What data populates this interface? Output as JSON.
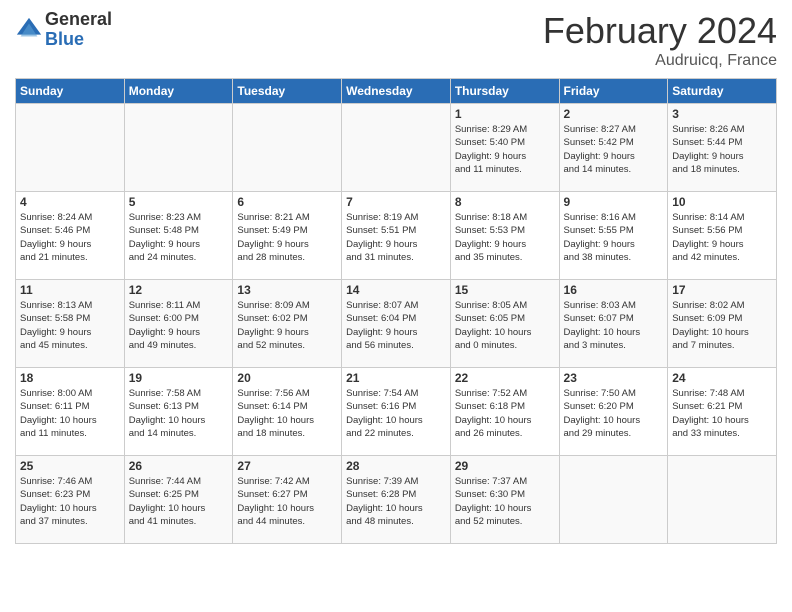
{
  "header": {
    "logo_general": "General",
    "logo_blue": "Blue",
    "title": "February 2024",
    "subtitle": "Audruicq, France"
  },
  "days_of_week": [
    "Sunday",
    "Monday",
    "Tuesday",
    "Wednesday",
    "Thursday",
    "Friday",
    "Saturday"
  ],
  "weeks": [
    [
      {
        "num": "",
        "info": ""
      },
      {
        "num": "",
        "info": ""
      },
      {
        "num": "",
        "info": ""
      },
      {
        "num": "",
        "info": ""
      },
      {
        "num": "1",
        "info": "Sunrise: 8:29 AM\nSunset: 5:40 PM\nDaylight: 9 hours\nand 11 minutes."
      },
      {
        "num": "2",
        "info": "Sunrise: 8:27 AM\nSunset: 5:42 PM\nDaylight: 9 hours\nand 14 minutes."
      },
      {
        "num": "3",
        "info": "Sunrise: 8:26 AM\nSunset: 5:44 PM\nDaylight: 9 hours\nand 18 minutes."
      }
    ],
    [
      {
        "num": "4",
        "info": "Sunrise: 8:24 AM\nSunset: 5:46 PM\nDaylight: 9 hours\nand 21 minutes."
      },
      {
        "num": "5",
        "info": "Sunrise: 8:23 AM\nSunset: 5:48 PM\nDaylight: 9 hours\nand 24 minutes."
      },
      {
        "num": "6",
        "info": "Sunrise: 8:21 AM\nSunset: 5:49 PM\nDaylight: 9 hours\nand 28 minutes."
      },
      {
        "num": "7",
        "info": "Sunrise: 8:19 AM\nSunset: 5:51 PM\nDaylight: 9 hours\nand 31 minutes."
      },
      {
        "num": "8",
        "info": "Sunrise: 8:18 AM\nSunset: 5:53 PM\nDaylight: 9 hours\nand 35 minutes."
      },
      {
        "num": "9",
        "info": "Sunrise: 8:16 AM\nSunset: 5:55 PM\nDaylight: 9 hours\nand 38 minutes."
      },
      {
        "num": "10",
        "info": "Sunrise: 8:14 AM\nSunset: 5:56 PM\nDaylight: 9 hours\nand 42 minutes."
      }
    ],
    [
      {
        "num": "11",
        "info": "Sunrise: 8:13 AM\nSunset: 5:58 PM\nDaylight: 9 hours\nand 45 minutes."
      },
      {
        "num": "12",
        "info": "Sunrise: 8:11 AM\nSunset: 6:00 PM\nDaylight: 9 hours\nand 49 minutes."
      },
      {
        "num": "13",
        "info": "Sunrise: 8:09 AM\nSunset: 6:02 PM\nDaylight: 9 hours\nand 52 minutes."
      },
      {
        "num": "14",
        "info": "Sunrise: 8:07 AM\nSunset: 6:04 PM\nDaylight: 9 hours\nand 56 minutes."
      },
      {
        "num": "15",
        "info": "Sunrise: 8:05 AM\nSunset: 6:05 PM\nDaylight: 10 hours\nand 0 minutes."
      },
      {
        "num": "16",
        "info": "Sunrise: 8:03 AM\nSunset: 6:07 PM\nDaylight: 10 hours\nand 3 minutes."
      },
      {
        "num": "17",
        "info": "Sunrise: 8:02 AM\nSunset: 6:09 PM\nDaylight: 10 hours\nand 7 minutes."
      }
    ],
    [
      {
        "num": "18",
        "info": "Sunrise: 8:00 AM\nSunset: 6:11 PM\nDaylight: 10 hours\nand 11 minutes."
      },
      {
        "num": "19",
        "info": "Sunrise: 7:58 AM\nSunset: 6:13 PM\nDaylight: 10 hours\nand 14 minutes."
      },
      {
        "num": "20",
        "info": "Sunrise: 7:56 AM\nSunset: 6:14 PM\nDaylight: 10 hours\nand 18 minutes."
      },
      {
        "num": "21",
        "info": "Sunrise: 7:54 AM\nSunset: 6:16 PM\nDaylight: 10 hours\nand 22 minutes."
      },
      {
        "num": "22",
        "info": "Sunrise: 7:52 AM\nSunset: 6:18 PM\nDaylight: 10 hours\nand 26 minutes."
      },
      {
        "num": "23",
        "info": "Sunrise: 7:50 AM\nSunset: 6:20 PM\nDaylight: 10 hours\nand 29 minutes."
      },
      {
        "num": "24",
        "info": "Sunrise: 7:48 AM\nSunset: 6:21 PM\nDaylight: 10 hours\nand 33 minutes."
      }
    ],
    [
      {
        "num": "25",
        "info": "Sunrise: 7:46 AM\nSunset: 6:23 PM\nDaylight: 10 hours\nand 37 minutes."
      },
      {
        "num": "26",
        "info": "Sunrise: 7:44 AM\nSunset: 6:25 PM\nDaylight: 10 hours\nand 41 minutes."
      },
      {
        "num": "27",
        "info": "Sunrise: 7:42 AM\nSunset: 6:27 PM\nDaylight: 10 hours\nand 44 minutes."
      },
      {
        "num": "28",
        "info": "Sunrise: 7:39 AM\nSunset: 6:28 PM\nDaylight: 10 hours\nand 48 minutes."
      },
      {
        "num": "29",
        "info": "Sunrise: 7:37 AM\nSunset: 6:30 PM\nDaylight: 10 hours\nand 52 minutes."
      },
      {
        "num": "",
        "info": ""
      },
      {
        "num": "",
        "info": ""
      }
    ]
  ]
}
